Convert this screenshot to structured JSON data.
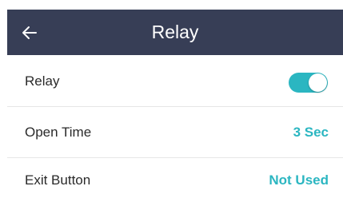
{
  "header": {
    "title": "Relay",
    "back_icon": "arrow-left-icon",
    "background": "#373e56"
  },
  "settings": {
    "relay": {
      "label": "Relay",
      "enabled": true
    },
    "open_time": {
      "label": "Open Time",
      "value": "3 Sec"
    },
    "exit_button": {
      "label": "Exit Button",
      "value": "Not Used"
    }
  },
  "colors": {
    "accent": "#2bb6c1",
    "text": "#2a2a2a",
    "divider": "#e6e6e6"
  }
}
